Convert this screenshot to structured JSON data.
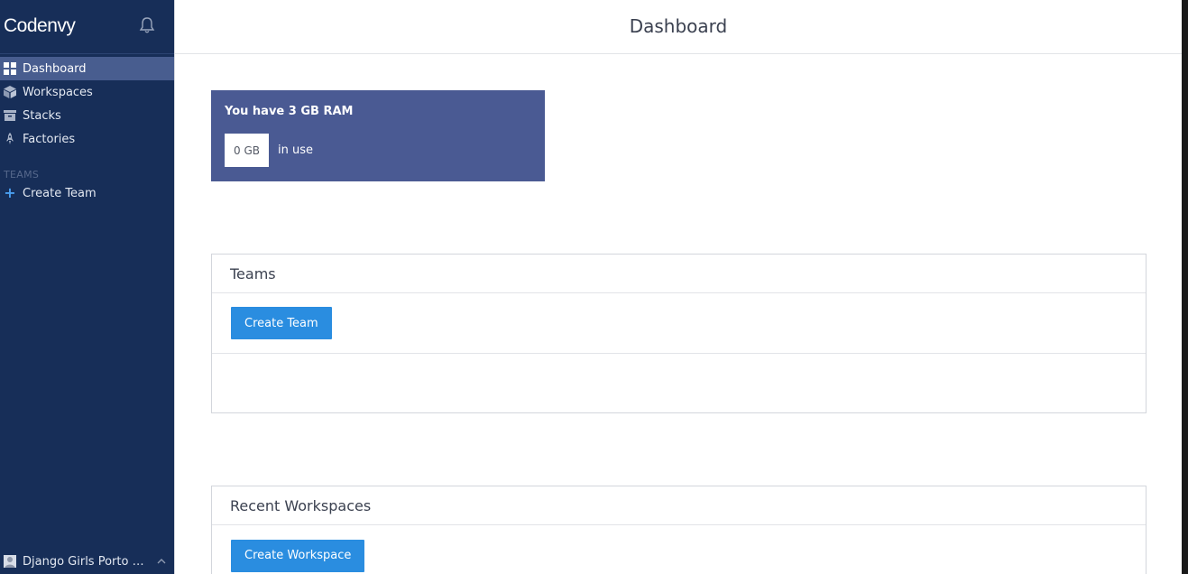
{
  "sidebar": {
    "brand": "Codenvy",
    "nav": [
      {
        "label": "Dashboard",
        "icon": "dashboard-grid-icon",
        "active": true
      },
      {
        "label": "Workspaces",
        "icon": "cube-icon",
        "active": false
      },
      {
        "label": "Stacks",
        "icon": "box-icon",
        "active": false
      },
      {
        "label": "Factories",
        "icon": "rocket-icon",
        "active": false
      }
    ],
    "teams_section_label": "TEAMS",
    "create_team_label": "Create Team",
    "account_name": "Django Girls Porto A..."
  },
  "header": {
    "title": "Dashboard"
  },
  "ram_card": {
    "title": "You have 3 GB RAM",
    "value": "0 GB",
    "suffix": "in use"
  },
  "teams_panel": {
    "title": "Teams",
    "button_label": "Create Team"
  },
  "workspaces_panel": {
    "title": "Recent Workspaces",
    "button_label": "Create Workspace"
  },
  "colors": {
    "sidebar_bg": "#172e58",
    "sidebar_active": "#485d8f",
    "ram_card_bg": "#4a5a93",
    "primary_button": "#2a8de0"
  }
}
